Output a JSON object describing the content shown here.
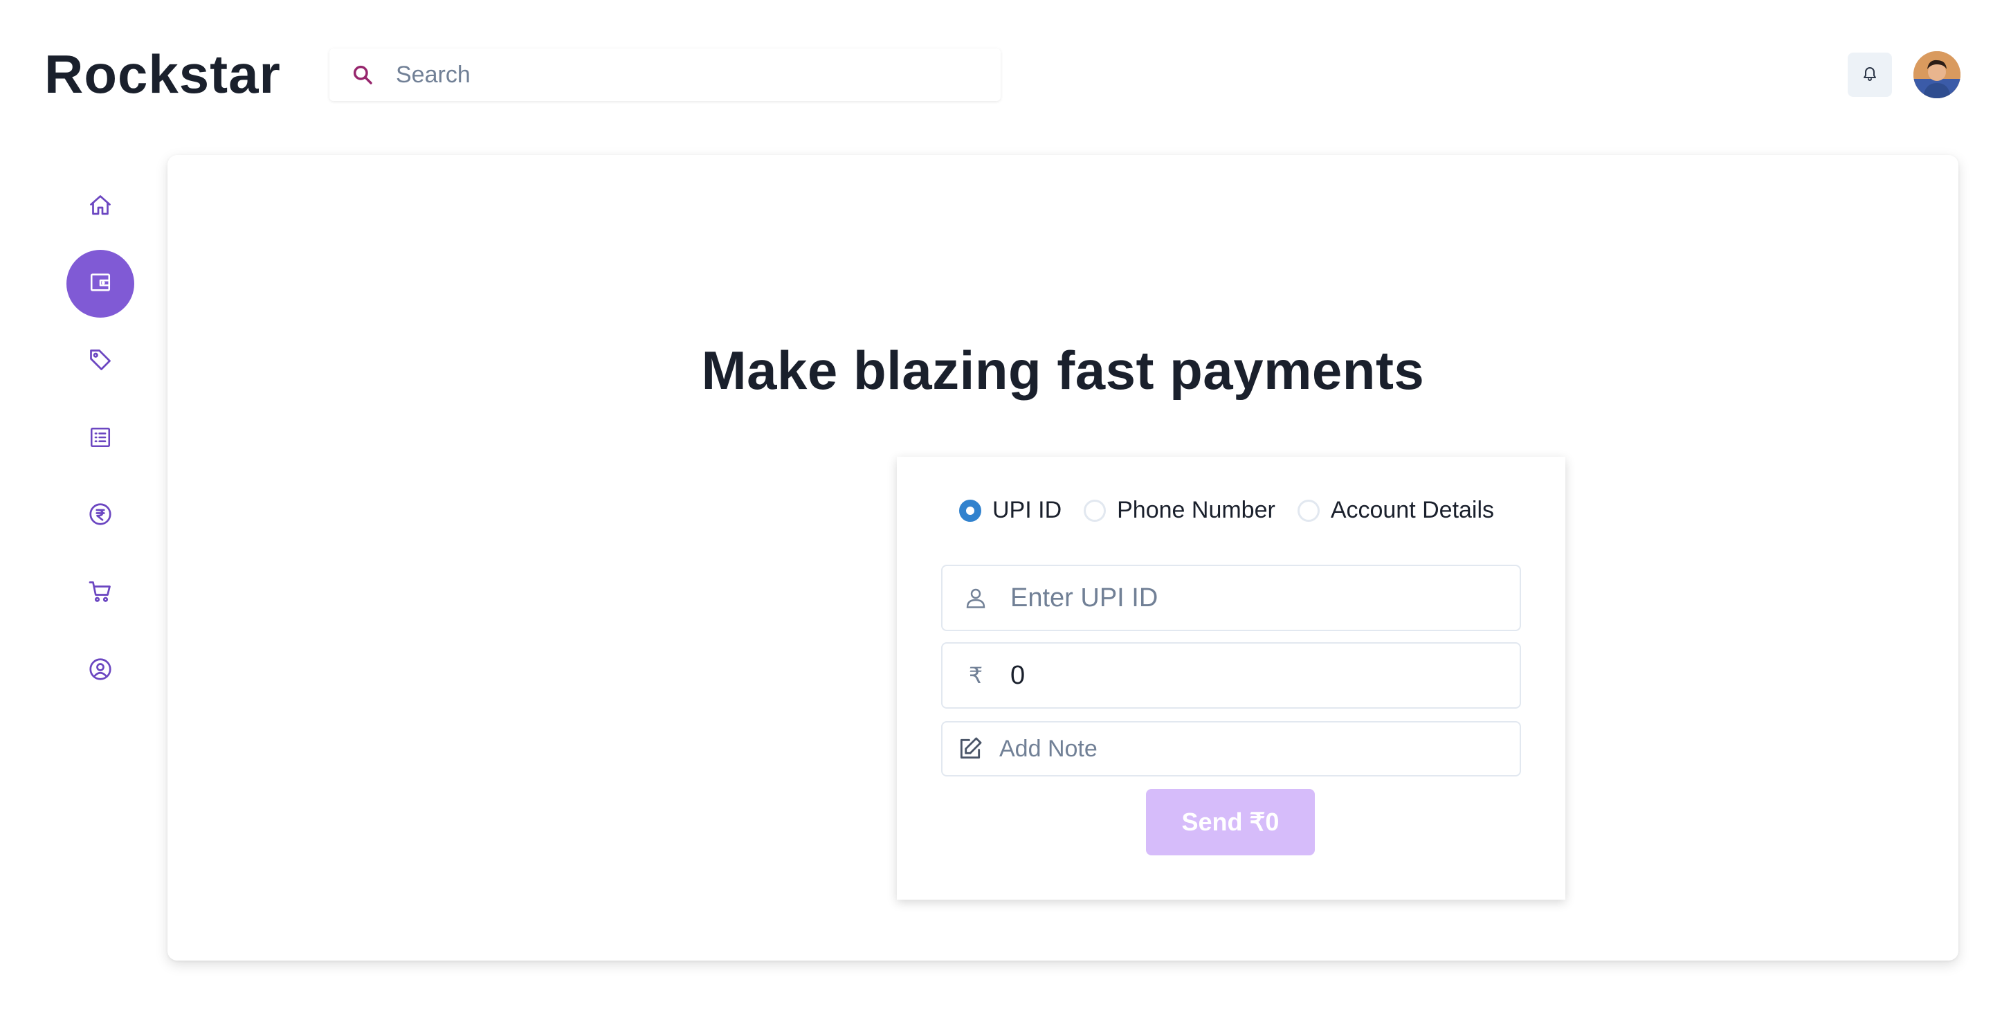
{
  "header": {
    "logo": "Rockstar",
    "search_placeholder": "Search",
    "notifications_icon": "bell-icon",
    "avatar_icon": "user-avatar"
  },
  "sidebar": {
    "items": [
      {
        "icon": "home-icon",
        "active": false
      },
      {
        "icon": "wallet-icon",
        "active": true
      },
      {
        "icon": "tag-icon",
        "active": false
      },
      {
        "icon": "list-icon",
        "active": false
      },
      {
        "icon": "rupee-circle-icon",
        "active": false
      },
      {
        "icon": "cart-icon",
        "active": false
      },
      {
        "icon": "user-circle-icon",
        "active": false
      }
    ]
  },
  "main": {
    "title": "Make blazing fast payments",
    "payment_methods": [
      {
        "label": "UPI ID",
        "checked": true
      },
      {
        "label": "Phone Number",
        "checked": false
      },
      {
        "label": "Account Details",
        "checked": false
      }
    ],
    "upi_field": {
      "placeholder": "Enter UPI ID",
      "value": ""
    },
    "amount_field": {
      "currency": "₹",
      "value": "0"
    },
    "note_field": {
      "placeholder": "Add Note",
      "value": ""
    },
    "send_button": "Send ₹0"
  },
  "colors": {
    "accent": "#805ad5",
    "accent_light": "#d6bcfa",
    "radio_checked": "#3182ce",
    "search_icon": "#97266d",
    "text": "#1a202c"
  }
}
